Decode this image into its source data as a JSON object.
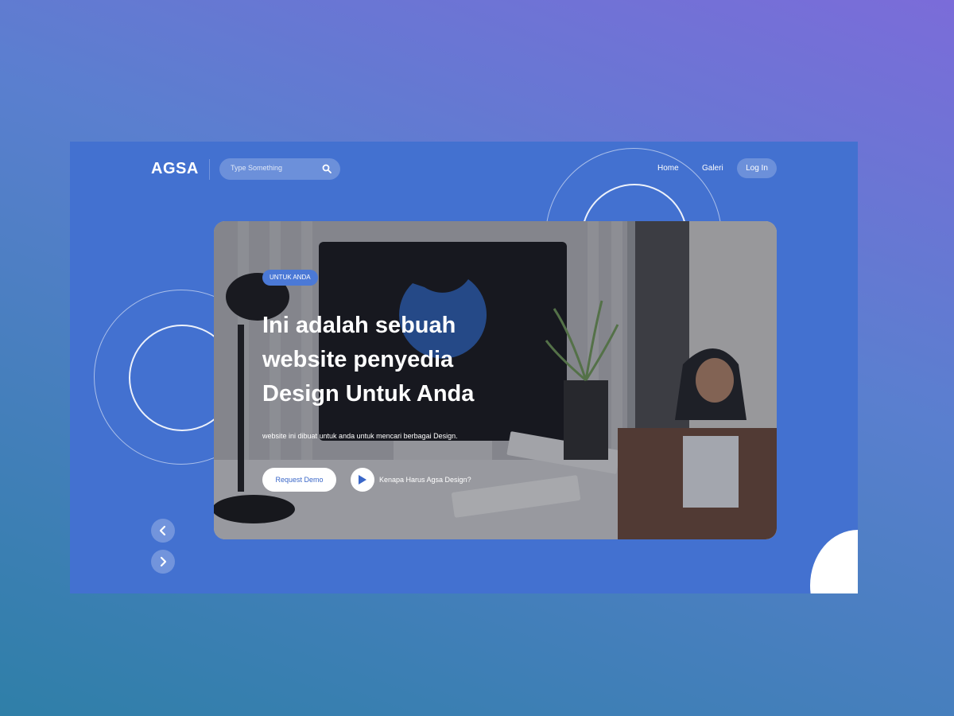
{
  "brand": {
    "logo": "AGSA"
  },
  "search": {
    "placeholder": "Type Something",
    "icon": "search-icon"
  },
  "nav": {
    "home": "Home",
    "galeri": "Galeri",
    "login": "Log In"
  },
  "hero": {
    "badge": "UNTUK ANDA",
    "headline": "Ini adalah sebuah website penyedia Design Untuk Anda",
    "subtitle": "website ini dibuat untuk anda untuk mencari berbagai Design.",
    "primary_button": "Request Demo",
    "secondary_link": "Kenapa Harus Agsa Design?"
  },
  "slider": {
    "prev_icon": "chevron-left-icon",
    "next_icon": "chevron-right-icon"
  },
  "colors": {
    "accent": "#4371d0",
    "badge": "#4b79d6",
    "button_text": "#3a67c8"
  }
}
